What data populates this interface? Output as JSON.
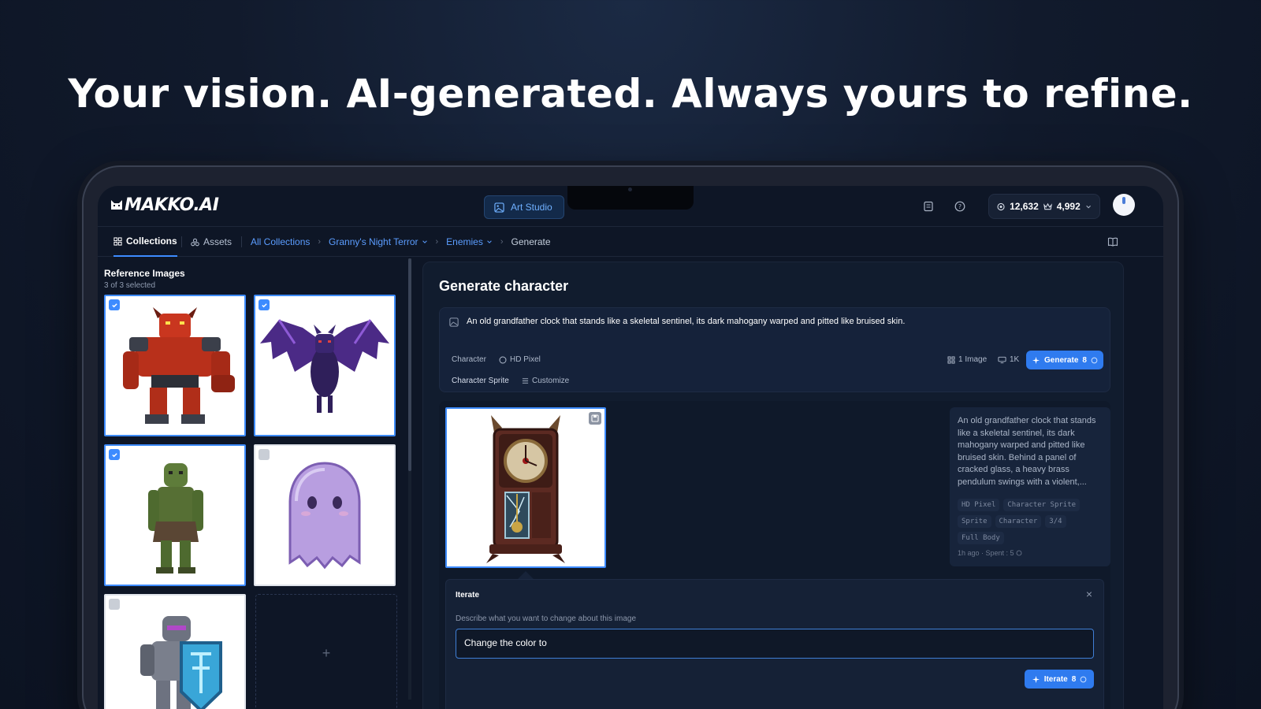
{
  "headline": "Your vision. AI-generated. Always yours to refine.",
  "app": {
    "logo": "MAKKO.AI",
    "studio_button": "Art Studio",
    "credits_a": "12,632",
    "credits_b": "4,992"
  },
  "nav": {
    "tabs": [
      {
        "label": "Collections",
        "active": true
      },
      {
        "label": "Assets",
        "active": false
      }
    ],
    "breadcrumbs": [
      "All Collections",
      "Granny's Night Terror",
      "Enemies",
      "Generate"
    ]
  },
  "reference": {
    "title": "Reference Images",
    "subtitle": "3 of 3 selected",
    "images": [
      {
        "subject": "red-demon",
        "selected": true
      },
      {
        "subject": "purple-bat",
        "selected": true
      },
      {
        "subject": "green-zombie",
        "selected": true
      },
      {
        "subject": "purple-ghost",
        "selected": false
      },
      {
        "subject": "armored-knight",
        "selected": false
      }
    ],
    "add_glyph": "+"
  },
  "generate": {
    "title": "Generate character",
    "prompt": "An old grandfather clock that stands like a skeletal sentinel, its dark mahogany warped and pitted like bruised skin.",
    "chip_type": "Character",
    "chip_style": "HD Pixel",
    "chip_sprite": "Character Sprite",
    "chip_customize": "Customize",
    "count_label": "1 Image",
    "resolution_label": "1K",
    "button_label": "Generate",
    "button_cost": "8"
  },
  "result": {
    "description": "An old grandfather clock that stands like a skeletal sentinel, its dark mahogany warped and pitted like bruised skin. Behind a panel of cracked glass, a heavy brass pendulum swings with a violent,...",
    "tags": [
      "HD Pixel",
      "Character Sprite",
      "Sprite",
      "Character",
      "3/4",
      "Full Body"
    ],
    "meta": "1h ago · Spent :  5"
  },
  "iterate": {
    "title": "Iterate",
    "close": "×",
    "label": "Describe what you want to change about this image",
    "input_value": "Change the color to",
    "button_label": "Iterate",
    "button_cost": "8"
  },
  "colors": {
    "accent": "#2f7bef",
    "link": "#5b9dff",
    "background": "#0e1626"
  }
}
